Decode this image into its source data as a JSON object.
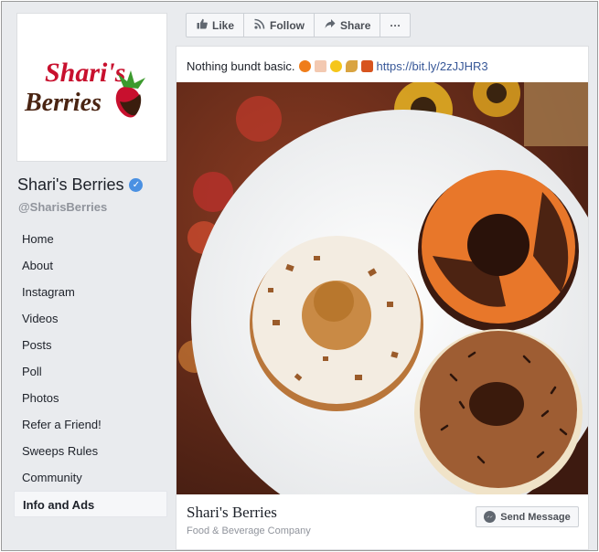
{
  "page": {
    "name": "Shari's Berries",
    "handle": "@SharisBerries",
    "logo_text_line1": "Shari's",
    "logo_text_line2": "Berries",
    "colors": {
      "brand_red": "#c8102e",
      "brand_brown": "#4a2412",
      "verified_blue": "#4a90e2",
      "link": "#385898"
    }
  },
  "sidebar": {
    "items": [
      {
        "label": "Home"
      },
      {
        "label": "About"
      },
      {
        "label": "Instagram"
      },
      {
        "label": "Videos"
      },
      {
        "label": "Posts"
      },
      {
        "label": "Poll"
      },
      {
        "label": "Photos"
      },
      {
        "label": "Refer a Friend!"
      },
      {
        "label": "Sweeps Rules"
      },
      {
        "label": "Community"
      },
      {
        "label": "Info and Ads"
      }
    ],
    "active": "Info and Ads"
  },
  "actions": {
    "like": "Like",
    "follow": "Follow",
    "share": "Share",
    "more": "···",
    "icons": {
      "like": "thumbs-up-icon",
      "follow": "rss-icon",
      "share": "share-arrow-icon"
    }
  },
  "post": {
    "caption": "Nothing bundt basic.",
    "emojis": [
      "jack-o-lantern",
      "cake",
      "heart-eyes",
      "leaves",
      "maple-leaf"
    ],
    "link": "https://bit.ly/2zJJHR3"
  },
  "footer": {
    "name": "Shari's Berries",
    "category": "Food & Beverage Company",
    "send_message": "Send Message"
  }
}
